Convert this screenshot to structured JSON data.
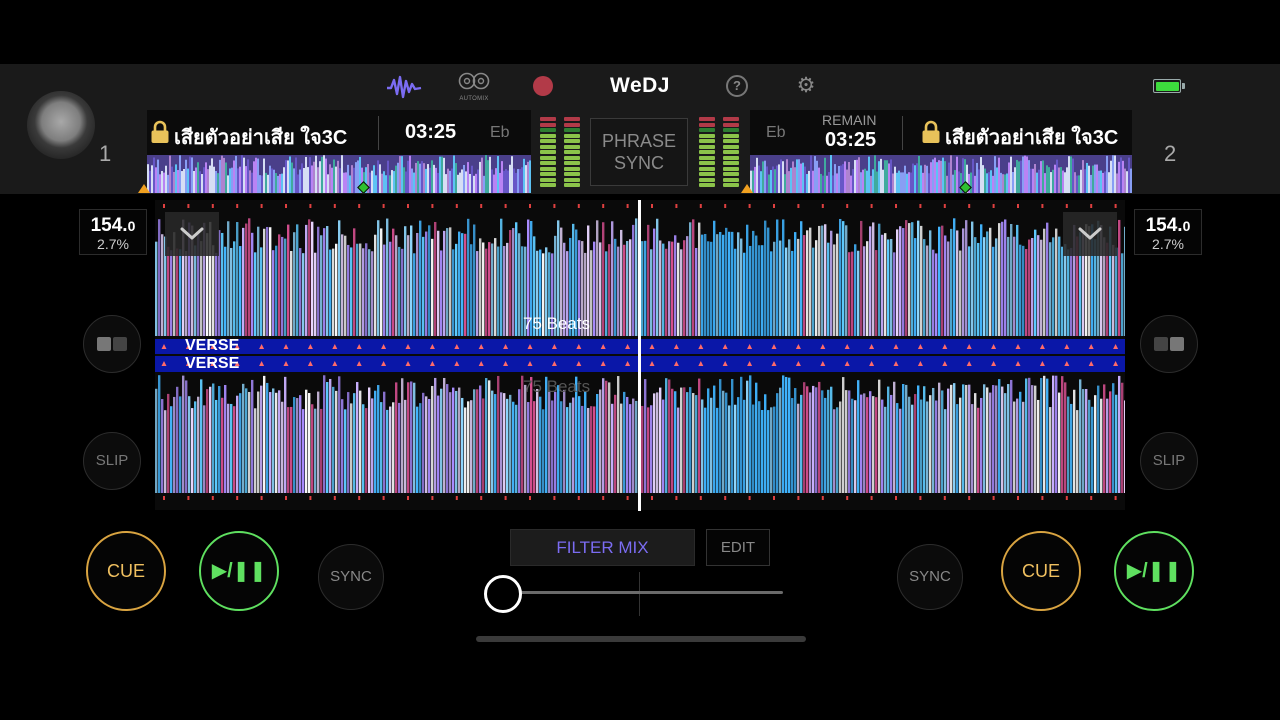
{
  "app": {
    "logo": "WeDJ",
    "automix_label": "AUTOMIX",
    "help_glyph": "?"
  },
  "colors": {
    "background": "#000000",
    "cue_ring": "#d9a441",
    "play_ring": "#5fe060",
    "filter_mix_text": "#7b6cf2",
    "phrase_lane": "#0a17a8",
    "beat_marker": "#e04040",
    "overview_marker": "#f0a020",
    "overview_diamond": "#2fc12f",
    "battery": "#3ddc3d"
  },
  "deck1": {
    "number": "1",
    "track_title": "เสียตัวอย่าเสีย ใจ3C",
    "time": "03:25",
    "key": "Eb",
    "bpm_int": "154.",
    "bpm_dec": "0",
    "pitch_pct": "2.7%",
    "slip_label": "SLIP",
    "cue_label": "CUE",
    "play_label": "▶/❚❚",
    "sync_label": "SYNC",
    "phrase_label": "VERSE"
  },
  "deck2": {
    "number": "2",
    "track_title": "เสียตัวอย่าเสีย ใจ3C",
    "remain_label": "REMAIN",
    "time": "03:25",
    "key": "Eb",
    "bpm_int": "154.",
    "bpm_dec": "0",
    "pitch_pct": "2.7%",
    "slip_label": "SLIP",
    "cue_label": "CUE",
    "play_label": "▶/❚❚",
    "sync_label": "SYNC",
    "phrase_label": "VERSE"
  },
  "center": {
    "phrase_sync_line1": "PHRASE",
    "phrase_sync_line2": "SYNC",
    "beats_label": "75 Beats",
    "beats_ghost": "75 Beats",
    "filter_mix_label": "FILTER MIX",
    "edit_label": "EDIT"
  },
  "crossfader": {
    "position": 0.0
  },
  "battery": {
    "level": 1.0
  },
  "icons": [
    "waveform-icon",
    "automix-icon",
    "record-icon",
    "help-icon",
    "gear-icon",
    "battery-icon",
    "lock-icon",
    "chevron-down-icon",
    "split-view-icon"
  ]
}
